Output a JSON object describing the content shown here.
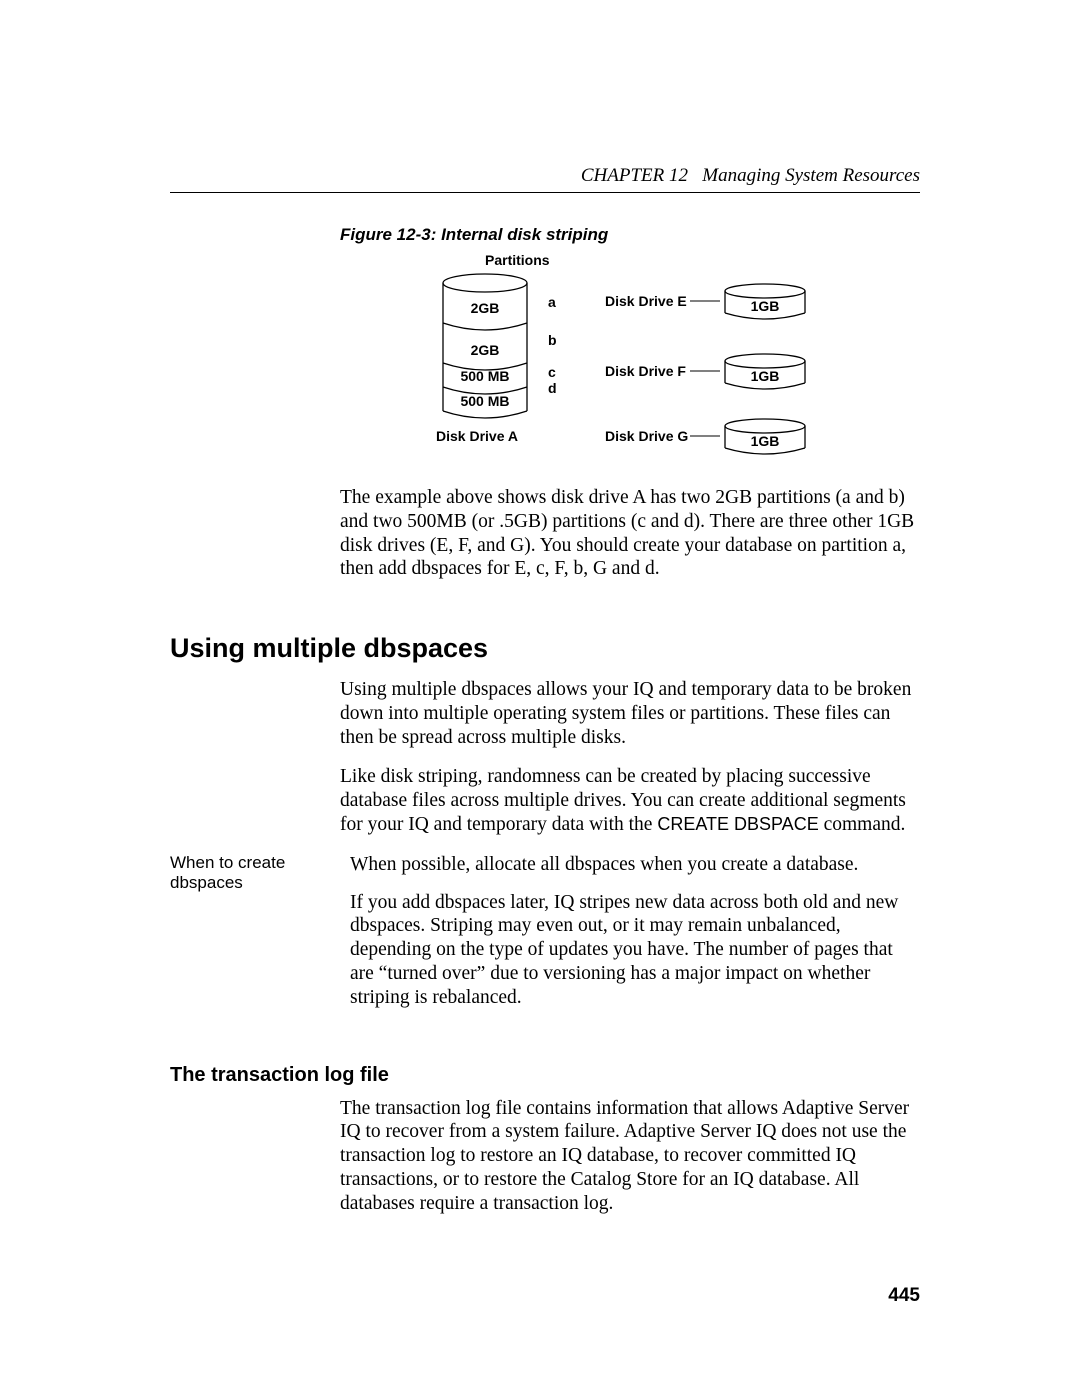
{
  "header": {
    "chapter": "CHAPTER 12",
    "title": "Managing System Resources"
  },
  "figure": {
    "caption": "Figure 12-3: Internal disk striping",
    "partitions_label": "Partitions",
    "driveA": {
      "label": "Disk Drive A",
      "p1": "2GB",
      "p1_letter": "a",
      "p2": "2GB",
      "p2_letter": "b",
      "p3": "500 MB",
      "p3_letter": "c",
      "p4": "500 MB",
      "p4_letter": "d"
    },
    "driveE": {
      "label": "Disk Drive E",
      "size": "1GB"
    },
    "driveF": {
      "label": "Disk Drive F",
      "size": "1GB"
    },
    "driveG": {
      "label": "Disk Drive G",
      "size": "1GB"
    }
  },
  "para1": "The example above shows disk drive A has two 2GB partitions (a and b) and two 500MB (or .5GB) partitions (c and d). There are three other 1GB disk drives (E, F, and G). You should create your database on partition a, then add dbspaces for E, c, F, b, G and d.",
  "section1": {
    "heading": "Using multiple dbspaces",
    "p1": "Using multiple dbspaces allows your IQ and temporary data to be broken down into multiple operating system files or partitions. These files can then be spread across multiple disks.",
    "p2_a": "Like disk striping, randomness can be created by placing successive database files across multiple drives. You can create additional segments for your IQ and temporary data with the ",
    "p2_cmd": "CREATE DBSPACE",
    "p2_b": " command.",
    "sidehead": "When to create dbspaces",
    "p3": "When possible, allocate all dbspaces when you create a database.",
    "p4": "If you add dbspaces later, IQ stripes new data across both old and new dbspaces. Striping may even out, or it may remain unbalanced, depending on the type of updates you have. The number of pages that are “turned over” due to versioning has a major impact on whether striping is rebalanced."
  },
  "section2": {
    "heading": "The transaction log file",
    "p1": "The transaction log file contains information that allows Adaptive Server IQ to recover from a system failure. Adaptive Server IQ does not use the transaction log to restore an IQ database, to recover committed IQ transactions, or to restore the Catalog Store for an IQ database. All databases require a transaction log."
  },
  "pagenum": "445"
}
